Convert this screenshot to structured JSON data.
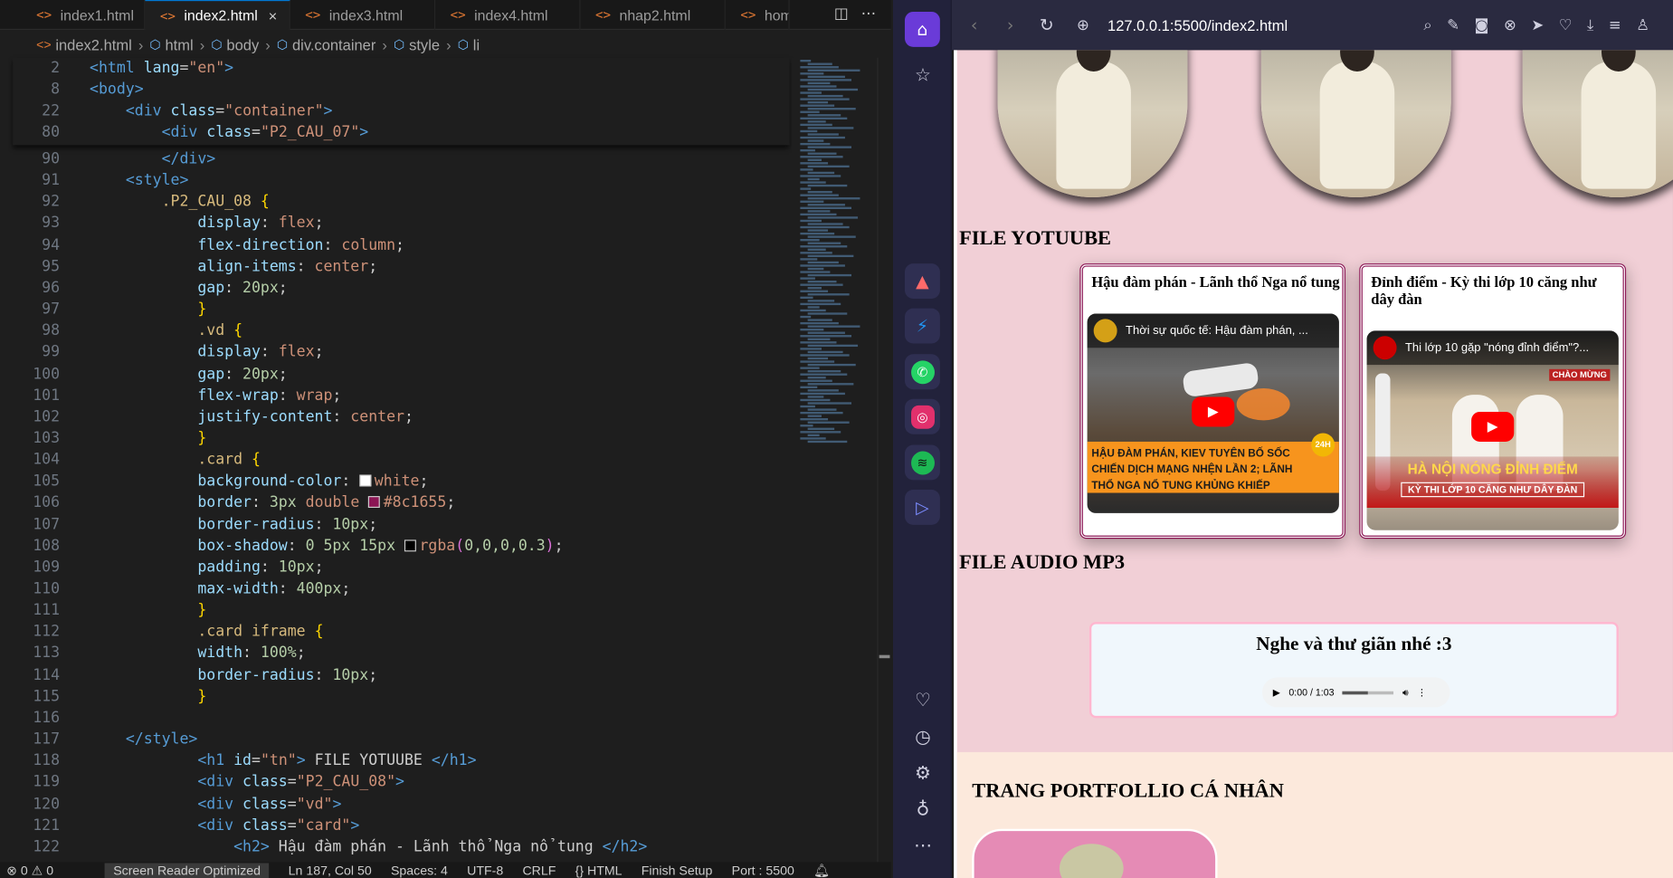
{
  "editor": {
    "tabs": [
      {
        "label": "index1.html",
        "active": false
      },
      {
        "label": "index2.html",
        "active": true
      },
      {
        "label": "index3.html",
        "active": false
      },
      {
        "label": "index4.html",
        "active": false
      },
      {
        "label": "nhap2.html",
        "active": false
      },
      {
        "label": "hom",
        "active": false
      }
    ],
    "tab_icon": "<>",
    "close_glyph": "×",
    "breadcrumb": [
      "index2.html",
      "html",
      "body",
      "div.container",
      "style",
      "li"
    ],
    "sticky_lines": [
      {
        "n": "2",
        "html": "<span class='tag'>&lt;html</span> <span class='at'>lang</span>=<span class='st'>\"en\"</span><span class='tag'>&gt;</span>"
      },
      {
        "n": "8",
        "html": "<span class='tag'>&lt;body&gt;</span>"
      },
      {
        "n": "22",
        "html": "    <span class='tag'>&lt;div</span> <span class='at'>class</span>=<span class='st'>\"container\"</span><span class='tag'>&gt;</span>"
      },
      {
        "n": "80",
        "html": "        <span class='tag'>&lt;div</span> <span class='at'>class</span>=<span class='st'>\"P2_CAU_07\"</span><span class='tag'>&gt;</span>"
      }
    ],
    "code_lines": [
      {
        "n": "90",
        "html": "        <span class='tag'>&lt;/div&gt;</span>"
      },
      {
        "n": "91",
        "html": "    <span class='tag'>&lt;style&gt;</span>"
      },
      {
        "n": "92",
        "html": "        <span class='sel'>.P2_CAU_08</span> <span class='br'>{</span>"
      },
      {
        "n": "93",
        "html": "            <span class='pr'>display</span>: <span class='vl'>flex</span>;"
      },
      {
        "n": "94",
        "html": "            <span class='pr'>flex-direction</span>: <span class='vl'>column</span>;"
      },
      {
        "n": "95",
        "html": "            <span class='pr'>align-items</span>: <span class='vl'>center</span>;"
      },
      {
        "n": "96",
        "html": "            <span class='pr'>gap</span>: <span class='nm'>20px</span>;"
      },
      {
        "n": "97",
        "html": "            <span class='br'>}</span>"
      },
      {
        "n": "98",
        "html": "            <span class='sel'>.vd</span> <span class='br'>{</span>"
      },
      {
        "n": "99",
        "html": "            <span class='pr'>display</span>: <span class='vl'>flex</span>;"
      },
      {
        "n": "100",
        "html": "            <span class='pr'>gap</span>: <span class='nm'>20px</span>;"
      },
      {
        "n": "101",
        "html": "            <span class='pr'>flex-wrap</span>: <span class='vl'>wrap</span>;"
      },
      {
        "n": "102",
        "html": "            <span class='pr'>justify-content</span>: <span class='vl'>center</span>;"
      },
      {
        "n": "103",
        "html": "            <span class='br'>}</span>"
      },
      {
        "n": "104",
        "html": "            <span class='sel'>.card</span> <span class='br'>{</span>"
      },
      {
        "n": "105",
        "html": "            <span class='pr'>background-color</span>: <span class='sw' style='background:#fff'></span><span class='vl'>white</span>;"
      },
      {
        "n": "106",
        "html": "            <span class='pr'>border</span>: <span class='nm'>3px</span> <span class='vl'>double</span> <span class='sw' style='background:#8c1655'></span><span class='vl'>#8c1655</span>;"
      },
      {
        "n": "107",
        "html": "            <span class='pr'>border-radius</span>: <span class='nm'>10px</span>;"
      },
      {
        "n": "108",
        "html": "            <span class='pr'>box-shadow</span>: <span class='nm'>0 5px 15px</span> <span class='sw' style='background:#000'></span><span class='vl'>rgba</span><span class='br2'>(</span><span class='nm'>0,0,0,0.3</span><span class='br2'>)</span>;"
      },
      {
        "n": "109",
        "html": "            <span class='pr'>padding</span>: <span class='nm'>10px</span>;"
      },
      {
        "n": "110",
        "html": "            <span class='pr'>max-width</span>: <span class='nm'>400px</span>;"
      },
      {
        "n": "111",
        "html": "            <span class='br'>}</span>"
      },
      {
        "n": "112",
        "html": "            <span class='sel'>.card iframe</span> <span class='br'>{</span>"
      },
      {
        "n": "113",
        "html": "            <span class='pr'>width</span>: <span class='nm'>100%</span>;"
      },
      {
        "n": "114",
        "html": "            <span class='pr'>border-radius</span>: <span class='nm'>10px</span>;"
      },
      {
        "n": "115",
        "html": "            <span class='br'>}</span>"
      },
      {
        "n": "116",
        "html": ""
      },
      {
        "n": "117",
        "html": "    <span class='tag'>&lt;/style&gt;</span>"
      },
      {
        "n": "118",
        "html": "            <span class='tag'>&lt;h1</span> <span class='at'>id</span>=<span class='st'>\"tn\"</span><span class='tag'>&gt;</span> FILE YOTUUBE <span class='tag'>&lt;/h1&gt;</span>"
      },
      {
        "n": "119",
        "html": "            <span class='tag'>&lt;div</span> <span class='at'>class</span>=<span class='st'>\"P2_CAU_08\"</span><span class='tag'>&gt;</span>"
      },
      {
        "n": "120",
        "html": "            <span class='tag'>&lt;div</span> <span class='at'>class</span>=<span class='st'>\"vd\"</span><span class='tag'>&gt;</span>"
      },
      {
        "n": "121",
        "html": "            <span class='tag'>&lt;div</span> <span class='at'>class</span>=<span class='st'>\"card\"</span><span class='tag'>&gt;</span>"
      },
      {
        "n": "122",
        "html": "                <span class='tag'>&lt;h2&gt;</span> Hậu đàm phán - Lãnh thổ Nga nổ tung <span class='tag'>&lt;/h2&gt;</span>"
      }
    ],
    "status": {
      "problems": "⊗ 0 ⚠ 0",
      "screen_reader": "Screen Reader Optimized",
      "position": "Ln 187, Col 50",
      "spaces": "Spaces: 4",
      "encoding": "UTF-8",
      "eol": "CRLF",
      "language": "{} HTML",
      "finish_setup": "Finish Setup",
      "port": "Port : 5500"
    }
  },
  "browser": {
    "url": "127.0.0.1:5500/index2.html",
    "page": {
      "youtube_heading": "FILE YOTUUBE",
      "videos": [
        {
          "card_title": "Hậu đàm phán - Lãnh thổ Nga nổ tung",
          "video_title": "Thời sự quốc tế: Hậu đàm phán, ...",
          "banner": "HẬU ĐÀM PHÁN, KIEV TUYÊN BỐ SỐC CHIẾN DỊCH MẠNG NHỆN LẦN 2; LÃNH THỔ NGA NỔ TUNG KHỦNG KHIẾP",
          "badge": "24H"
        },
        {
          "card_title": "Đỉnh điểm - Kỳ thi lớp 10 căng như dây đàn",
          "video_title": "Thi lớp 10 gặp \"nóng đỉnh điểm\"?...",
          "banner_title": "HÀ NỘI NÓNG ĐỈNH ĐIỂM",
          "banner_sub": "KỲ THI LỚP 10 CĂNG NHƯ DÂY ĐÀN",
          "corner": "CHÀO MỪNG"
        }
      ],
      "audio_heading": "FILE AUDIO MP3",
      "audio_title": "Nghe và thư giãn nhé :3",
      "audio_time": "0:00 / 1:03",
      "portfolio_heading": "TRANG PORTFOLLIO CÁ NHÂN"
    }
  },
  "colors": {
    "accent": "#0078d4",
    "card_border": "#8c1655",
    "page_bg": "#f1cfd6"
  }
}
